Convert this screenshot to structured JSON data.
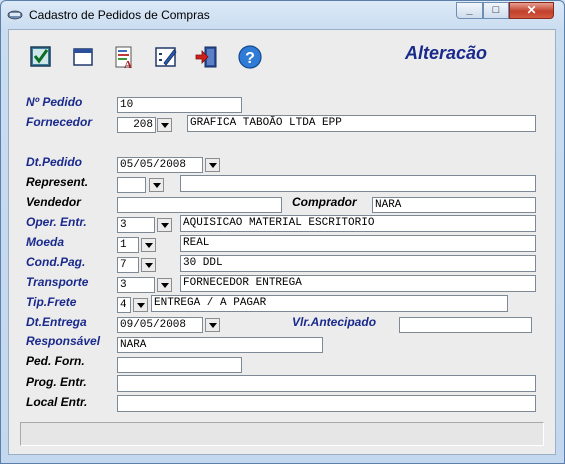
{
  "window": {
    "title": "Cadastro de Pedidos de Compras",
    "mode_label": "Alteracão"
  },
  "toolbar": [
    {
      "icon": "confirm-check-icon"
    },
    {
      "icon": "window-icon"
    },
    {
      "icon": "document-print-icon"
    },
    {
      "icon": "edit-form-icon"
    },
    {
      "icon": "exit-door-icon"
    },
    {
      "icon": "help-icon"
    }
  ],
  "form": {
    "n_pedido": {
      "label": "Nº Pedido",
      "value": "10"
    },
    "fornecedor": {
      "label": "Fornecedor",
      "code": "208",
      "name": "GRAFICA TABOÃO LTDA EPP"
    },
    "dt_pedido": {
      "label": "Dt.Pedido",
      "value": "05/05/2008"
    },
    "represent": {
      "label": "Represent.",
      "code": "",
      "name": ""
    },
    "vendedor": {
      "label": "Vendedor",
      "value": ""
    },
    "comprador": {
      "label": "Comprador",
      "value": "NARA"
    },
    "oper_entr": {
      "label": "Oper. Entr.",
      "code": "3",
      "name": "AQUISICAO MATERIAL ESCRITORIO"
    },
    "moeda": {
      "label": "Moeda",
      "code": "1",
      "name": "REAL"
    },
    "cond_pag": {
      "label": "Cond.Pag.",
      "code": "7",
      "name": "30 DDL"
    },
    "transporte": {
      "label": "Transporte",
      "code": "3",
      "name": "FORNECEDOR ENTREGA"
    },
    "tip_frete": {
      "label": "Tip.Frete",
      "code": "4",
      "name": "ENTREGA / A PAGAR"
    },
    "dt_entrega": {
      "label": "Dt.Entrega",
      "value": "09/05/2008"
    },
    "vlr_antecipado": {
      "label": "Vlr.Antecipado",
      "value": ""
    },
    "responsavel": {
      "label": "Responsável",
      "value": "NARA"
    },
    "ped_forn": {
      "label": "Ped. Forn.",
      "value": ""
    },
    "prog_entr": {
      "label": "Prog. Entr.",
      "value": ""
    },
    "local_entr": {
      "label": "Local Entr.",
      "value": ""
    }
  },
  "colors": {
    "label_blue": "#1a2a8c",
    "label_black": "#000000",
    "client_bg": "#ececec"
  }
}
